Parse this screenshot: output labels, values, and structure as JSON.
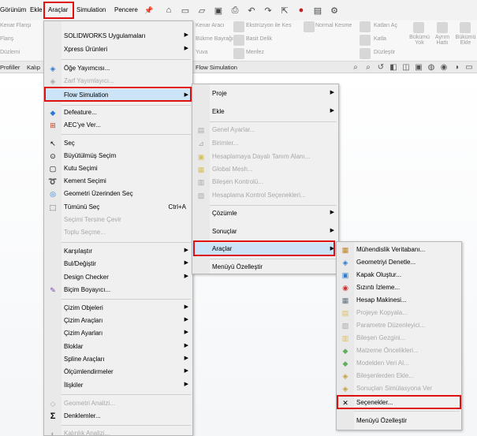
{
  "menubar": {
    "items": [
      "Görünüm",
      "Ekle",
      "Araçlar",
      "Simulation",
      "Pencere"
    ]
  },
  "ribbon": {
    "labels": [
      "Kenar Flanşı",
      "Flanş",
      "Düzlemi",
      "Kenar Aracı",
      "Bükme Bayrağı",
      "Yuva",
      "Ekstrüzyon ile Kes",
      "Basit Delik",
      "Menfez",
      "Normal Kesme",
      "Katları Aç",
      "Katla",
      "Düzleştir",
      "Bükümü Yok",
      "Ayrım Hattı",
      "Bükümü Ekle"
    ]
  },
  "tabs": [
    "Profiller",
    "Kalıp",
    "Flow Simulation"
  ],
  "menu1": {
    "items": [
      {
        "label": "SOLIDWORKS Uygulamaları",
        "arrow": true,
        "disabled": false,
        "icon": ""
      },
      {
        "label": "Xpress Ürünleri",
        "arrow": true,
        "disabled": false,
        "icon": ""
      },
      {
        "label": "Öğe Yayımcısı...",
        "arrow": false,
        "disabled": false,
        "icon": "feature-publisher-icon"
      },
      {
        "label": "Zarf Yayımlayıcı...",
        "arrow": false,
        "disabled": true,
        "icon": "envelope-publisher-icon"
      },
      {
        "label": "Flow Simulation",
        "arrow": true,
        "disabled": false,
        "icon": ""
      },
      {
        "label": "Defeature...",
        "arrow": false,
        "disabled": false,
        "icon": "defeature-icon"
      },
      {
        "label": "AEC'ye Ver...",
        "arrow": false,
        "disabled": false,
        "icon": "aec-export-icon"
      },
      {
        "label": "Seç",
        "arrow": false,
        "disabled": false,
        "icon": "select-cursor-icon"
      },
      {
        "label": "Büyütülmüş Seçim",
        "arrow": false,
        "disabled": false,
        "icon": "magnified-selection-icon"
      },
      {
        "label": "Kutu Seçimi",
        "arrow": false,
        "disabled": false,
        "icon": "box-selection-icon"
      },
      {
        "label": "Kement Seçimi",
        "arrow": false,
        "disabled": false,
        "icon": "lasso-selection-icon"
      },
      {
        "label": "Geometri Üzerinden Seç",
        "arrow": false,
        "disabled": false,
        "icon": "select-through-geometry-icon"
      },
      {
        "label": "Tümünü Seç",
        "arrow": false,
        "disabled": false,
        "icon": "select-all-icon",
        "shortcut": "Ctrl+A"
      },
      {
        "label": "Seçimi Tersine Çevir",
        "arrow": false,
        "disabled": true,
        "icon": ""
      },
      {
        "label": "Toplu Seçme...",
        "arrow": false,
        "disabled": true,
        "icon": ""
      },
      {
        "label": "Karşılaştır",
        "arrow": true,
        "disabled": false,
        "icon": ""
      },
      {
        "label": "Bul/Değiştir",
        "arrow": true,
        "disabled": false,
        "icon": ""
      },
      {
        "label": "Design Checker",
        "arrow": true,
        "disabled": false,
        "icon": ""
      },
      {
        "label": "Biçim Boyayıcı...",
        "arrow": false,
        "disabled": false,
        "icon": "format-painter-icon"
      },
      {
        "label": "Çizim Objeleri",
        "arrow": true,
        "disabled": false,
        "icon": ""
      },
      {
        "label": "Çizim Araçları",
        "arrow": true,
        "disabled": false,
        "icon": ""
      },
      {
        "label": "Çizim Ayarları",
        "arrow": true,
        "disabled": false,
        "icon": ""
      },
      {
        "label": "Bloklar",
        "arrow": true,
        "disabled": false,
        "icon": ""
      },
      {
        "label": "Spline Araçları",
        "arrow": true,
        "disabled": false,
        "icon": ""
      },
      {
        "label": "Ölçümlendirmeler",
        "arrow": true,
        "disabled": false,
        "icon": ""
      },
      {
        "label": "İlişkiler",
        "arrow": true,
        "disabled": false,
        "icon": ""
      },
      {
        "label": "Geometri Analizi...",
        "arrow": false,
        "disabled": true,
        "icon": "geometry-analysis-icon"
      },
      {
        "label": "Denklemler...",
        "arrow": false,
        "disabled": false,
        "icon": "sigma-icon"
      },
      {
        "label": "Kalınlık Analizi...",
        "arrow": false,
        "disabled": true,
        "icon": "thickness-analysis-icon"
      }
    ]
  },
  "menu2": {
    "items": [
      {
        "label": "Proje",
        "arrow": true,
        "disabled": false,
        "icon": ""
      },
      {
        "label": "Ekle",
        "arrow": true,
        "disabled": false,
        "icon": ""
      },
      {
        "label": "Genel Ayarlar...",
        "arrow": false,
        "disabled": true,
        "icon": "general-settings-icon"
      },
      {
        "label": "Birimler...",
        "arrow": false,
        "disabled": true,
        "icon": "units-icon"
      },
      {
        "label": "Hesaplamaya Dayalı Tanım Alanı...",
        "arrow": false,
        "disabled": true,
        "icon": "computational-domain-icon"
      },
      {
        "label": "Global Mesh...",
        "arrow": false,
        "disabled": true,
        "icon": "global-mesh-icon"
      },
      {
        "label": "Bileşen Kontrolü...",
        "arrow": false,
        "disabled": true,
        "icon": "component-control-icon"
      },
      {
        "label": "Hesaplama Kontrol Seçenekleri...",
        "arrow": false,
        "disabled": true,
        "icon": "calculation-control-icon"
      },
      {
        "label": "Çözümle",
        "arrow": true,
        "disabled": false,
        "icon": ""
      },
      {
        "label": "Sonuçlar",
        "arrow": true,
        "disabled": false,
        "icon": ""
      },
      {
        "label": "Araçlar",
        "arrow": true,
        "disabled": false,
        "icon": ""
      },
      {
        "label": "Menüyü Özelleştir",
        "arrow": false,
        "disabled": false,
        "icon": ""
      }
    ]
  },
  "menu3": {
    "items": [
      {
        "label": "Mühendislik Veritabanı...",
        "disabled": false,
        "icon": "engineering-database-icon"
      },
      {
        "label": "Geometriyi Denetle...",
        "disabled": false,
        "icon": "check-geometry-icon"
      },
      {
        "label": "Kapak Oluştur...",
        "disabled": false,
        "icon": "create-lids-icon"
      },
      {
        "label": "Sızıntı İzleme...",
        "disabled": false,
        "icon": "leak-tracking-icon"
      },
      {
        "label": "Hesap Makinesi...",
        "disabled": false,
        "icon": "calculator-icon"
      },
      {
        "label": "Projeye Kopyala...",
        "disabled": true,
        "icon": "copy-to-project-icon"
      },
      {
        "label": "Parametre Düzenleyici...",
        "disabled": true,
        "icon": "parameter-editor-icon"
      },
      {
        "label": "Bileşen Gezgini...",
        "disabled": true,
        "icon": "component-explorer-icon"
      },
      {
        "label": "Malzeme Öncelikleri...",
        "disabled": true,
        "icon": "material-priorities-icon"
      },
      {
        "label": "Modelden Veri Al...",
        "disabled": true,
        "icon": "get-data-from-model-icon"
      },
      {
        "label": "Bileşenlerden Ekle...",
        "disabled": true,
        "icon": "add-from-components-icon"
      },
      {
        "label": "Sonuçları Simülasyona Ver",
        "disabled": true,
        "icon": "export-results-icon"
      },
      {
        "label": "Seçenekler...",
        "disabled": false,
        "icon": "options-tools-icon"
      },
      {
        "label": "Menüyü Özelleştir",
        "disabled": false,
        "icon": ""
      }
    ]
  }
}
